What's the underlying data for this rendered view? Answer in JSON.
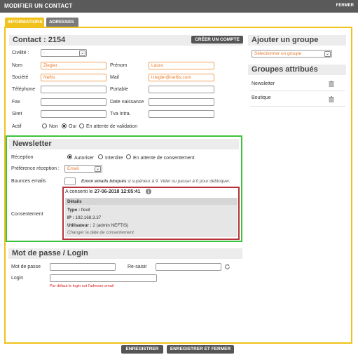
{
  "window": {
    "title": "MODIFIER UN CONTACT",
    "close_label": "FERMER"
  },
  "tabs": [
    {
      "label": "INFORMATIONS",
      "active": true
    },
    {
      "label": "ADRESSES",
      "active": false
    }
  ],
  "contact": {
    "header": "Contact : 2154",
    "create_account_label": "CRÉER UN COMPTE",
    "civilite": {
      "label": "Civilité :",
      "value": "-"
    },
    "nom": {
      "label": "Nom",
      "value": "Ziegler"
    },
    "prenom": {
      "label": "Prénom",
      "value": "Laura"
    },
    "societe": {
      "label": "Société",
      "value": "Neftis"
    },
    "mail": {
      "label": "Mail",
      "value": "lziegler@neftis.com"
    },
    "telephone": {
      "label": "Téléphone",
      "value": ""
    },
    "portable": {
      "label": "Portable",
      "value": ""
    },
    "fax": {
      "label": "Fax",
      "value": ""
    },
    "date_naissance": {
      "label": "Date naissance",
      "value": ""
    },
    "siret": {
      "label": "Siret",
      "value": ""
    },
    "tva": {
      "label": "Tva Intra.",
      "value": ""
    },
    "actif": {
      "label": "Actif",
      "options": [
        "Non",
        "Oui",
        "En attente de validation"
      ],
      "selected": "Oui"
    }
  },
  "groups": {
    "add_header": "Ajouter un groupe",
    "select_placeholder": "Sélectionner un groupe",
    "assigned_header": "Groupes attribués",
    "items": [
      "Newsletter",
      "Boutique"
    ]
  },
  "newsletter": {
    "header": "Newsletter",
    "reception": {
      "label": "Réception",
      "options": [
        "Autoriser",
        "Interdire",
        "En attente de consentement"
      ],
      "selected": "Autoriser"
    },
    "preference": {
      "label": "Préférence réception :",
      "value": "Email"
    },
    "bounces": {
      "label": "Bounces emails",
      "value": "",
      "help_bold": "Envoi emails bloqués",
      "help_rest": " si supérieur à 9. Vider ou passer à 0 pour débloquer."
    },
    "consent": {
      "label": "Consentement",
      "line_prefix": "A consenti le ",
      "date": "27-06-2018 12:05:41",
      "details_title": "Détails",
      "type_label": "Type : ",
      "type_value": "flexit",
      "ip_label": "IP : ",
      "ip_value": "192.168.3.37",
      "user_label": "Utilisateur : ",
      "user_value": "2 (admin NEFTIS)",
      "change_link": "Changer la date de consentement"
    }
  },
  "password": {
    "header": "Mot de passe / Login",
    "password_label": "Mot de passe",
    "resaisir_label": "Re-saisir",
    "login_label": "Login",
    "login_hint": "Par défaut le login est l'adresse email"
  },
  "footer": {
    "save_label": "ENREGISTRER",
    "save_close_label": "ENREGISTRER ET FERMER"
  },
  "colors": {
    "accent": "#f1c21b",
    "newsletter_border": "#3fc33f",
    "consent_border": "#b8323c",
    "input_text": "#e87b2c"
  }
}
